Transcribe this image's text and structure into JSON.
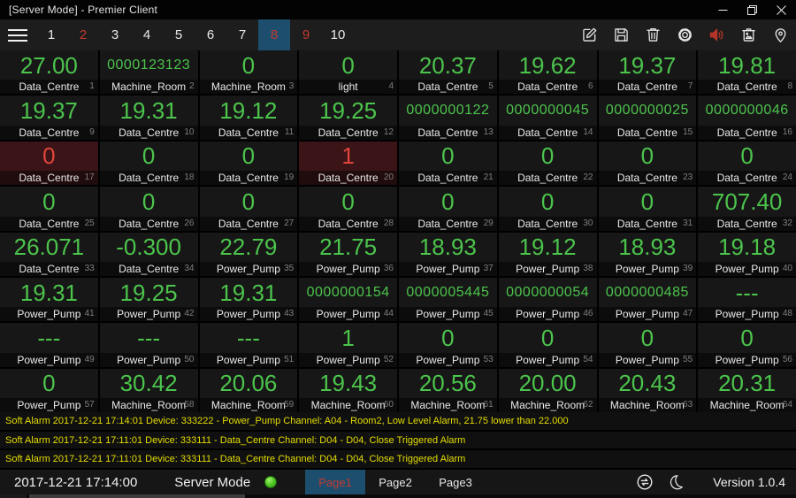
{
  "colors": {
    "accent_blue": "#1d4e6d",
    "value_green": "#4cc44c",
    "alarm_red": "#df453a",
    "page_red": "#c23b31",
    "alarm_text_yellow": "#e6de00",
    "alarm_cell_bg": "#3b1418"
  },
  "title_bar": {
    "title": "[Server Mode] - Premier Client"
  },
  "window_controls": {
    "icons": [
      "minimize-icon",
      "restore-icon",
      "close-icon"
    ]
  },
  "toolbar": {
    "pages": [
      {
        "label": "1",
        "state": "normal"
      },
      {
        "label": "2",
        "state": "alarm"
      },
      {
        "label": "3",
        "state": "normal"
      },
      {
        "label": "4",
        "state": "normal"
      },
      {
        "label": "5",
        "state": "normal"
      },
      {
        "label": "6",
        "state": "normal"
      },
      {
        "label": "7",
        "state": "normal"
      },
      {
        "label": "8",
        "state": "active"
      },
      {
        "label": "9",
        "state": "alarm"
      },
      {
        "label": "10",
        "state": "normal"
      }
    ],
    "icons": [
      "edit-icon",
      "save-icon",
      "delete-icon",
      "settings-icon",
      "audio-icon",
      "snapshot-icon",
      "location-icon"
    ]
  },
  "grid": {
    "cells": [
      {
        "value": "27.00",
        "label": "Data_Centre",
        "index": 1
      },
      {
        "value": "0000123123",
        "label": "Machine_Room",
        "index": 2
      },
      {
        "value": "0",
        "label": "Machine_Room",
        "index": 3
      },
      {
        "value": "0",
        "label": "light",
        "index": 4
      },
      {
        "value": "20.37",
        "label": "Data_Centre",
        "index": 5
      },
      {
        "value": "19.62",
        "label": "Data_Centre",
        "index": 6
      },
      {
        "value": "19.37",
        "label": "Data_Centre",
        "index": 7
      },
      {
        "value": "19.81",
        "label": "Data_Centre",
        "index": 8
      },
      {
        "value": "19.37",
        "label": "Data_Centre",
        "index": 9
      },
      {
        "value": "19.31",
        "label": "Data_Centre",
        "index": 10
      },
      {
        "value": "19.12",
        "label": "Data_Centre",
        "index": 11
      },
      {
        "value": "19.25",
        "label": "Data_Centre",
        "index": 12
      },
      {
        "value": "0000000122",
        "label": "Data_Centre",
        "index": 13
      },
      {
        "value": "0000000045",
        "label": "Data_Centre",
        "index": 14
      },
      {
        "value": "0000000025",
        "label": "Data_Centre",
        "index": 15
      },
      {
        "value": "0000000046",
        "label": "Data_Centre",
        "index": 16
      },
      {
        "value": "0",
        "label": "Data_Centre",
        "index": 17,
        "state": "alarm"
      },
      {
        "value": "0",
        "label": "Data_Centre",
        "index": 18
      },
      {
        "value": "0",
        "label": "Data_Centre",
        "index": 19
      },
      {
        "value": "1",
        "label": "Data_Centre",
        "index": 20,
        "state": "alarm"
      },
      {
        "value": "0",
        "label": "Data_Centre",
        "index": 21
      },
      {
        "value": "0",
        "label": "Data_Centre",
        "index": 22
      },
      {
        "value": "0",
        "label": "Data_Centre",
        "index": 23
      },
      {
        "value": "0",
        "label": "Data_Centre",
        "index": 24
      },
      {
        "value": "0",
        "label": "Data_Centre",
        "index": 25
      },
      {
        "value": "0",
        "label": "Data_Centre",
        "index": 26
      },
      {
        "value": "0",
        "label": "Data_Centre",
        "index": 27
      },
      {
        "value": "0",
        "label": "Data_Centre",
        "index": 28
      },
      {
        "value": "0",
        "label": "Data_Centre",
        "index": 29
      },
      {
        "value": "0",
        "label": "Data_Centre",
        "index": 30
      },
      {
        "value": "0",
        "label": "Data_Centre",
        "index": 31
      },
      {
        "value": "707.40",
        "label": "Data_Centre",
        "index": 32
      },
      {
        "value": "26.071",
        "label": "Data_Centre",
        "index": 33
      },
      {
        "value": "-0.300",
        "label": "Data_Centre",
        "index": 34
      },
      {
        "value": "22.79",
        "label": "Power_Pump",
        "index": 35
      },
      {
        "value": "21.75",
        "label": "Power_Pump",
        "index": 36
      },
      {
        "value": "18.93",
        "label": "Power_Pump",
        "index": 37
      },
      {
        "value": "19.12",
        "label": "Power_Pump",
        "index": 38
      },
      {
        "value": "18.93",
        "label": "Power_Pump",
        "index": 39
      },
      {
        "value": "19.18",
        "label": "Power_Pump",
        "index": 40
      },
      {
        "value": "19.31",
        "label": "Power_Pump",
        "index": 41
      },
      {
        "value": "19.25",
        "label": "Power_Pump",
        "index": 42
      },
      {
        "value": "19.31",
        "label": "Power_Pump",
        "index": 43
      },
      {
        "value": "0000000154",
        "label": "Power_Pump",
        "index": 44
      },
      {
        "value": "0000005445",
        "label": "Power_Pump",
        "index": 45
      },
      {
        "value": "0000000054",
        "label": "Power_Pump",
        "index": 46
      },
      {
        "value": "0000000485",
        "label": "Power_Pump",
        "index": 47
      },
      {
        "value": "---",
        "label": "Power_Pump",
        "index": 48
      },
      {
        "value": "---",
        "label": "Power_Pump",
        "index": 49
      },
      {
        "value": "---",
        "label": "Power_Pump",
        "index": 50
      },
      {
        "value": "---",
        "label": "Power_Pump",
        "index": 51
      },
      {
        "value": "1",
        "label": "Power_Pump",
        "index": 52
      },
      {
        "value": "0",
        "label": "Power_Pump",
        "index": 53
      },
      {
        "value": "0",
        "label": "Power_Pump",
        "index": 54
      },
      {
        "value": "0",
        "label": "Power_Pump",
        "index": 55
      },
      {
        "value": "0",
        "label": "Power_Pump",
        "index": 56
      },
      {
        "value": "0",
        "label": "Power_Pump",
        "index": 57
      },
      {
        "value": "30.42",
        "label": "Machine_Room",
        "index": 58
      },
      {
        "value": "20.06",
        "label": "Machine_Room",
        "index": 59
      },
      {
        "value": "19.43",
        "label": "Machine_Room",
        "index": 60
      },
      {
        "value": "20.56",
        "label": "Machine_Room",
        "index": 61
      },
      {
        "value": "20.00",
        "label": "Machine_Room",
        "index": 62
      },
      {
        "value": "20.43",
        "label": "Machine_Room",
        "index": 63
      },
      {
        "value": "20.31",
        "label": "Machine_Room",
        "index": 64
      }
    ]
  },
  "alarms": {
    "messages": [
      "Soft Alarm 2017-12-21 17:14:01 Device: 333222 - Power_Pump Channel: A04 - Room2, Low Level Alarm, 21.75 lower than 22.000",
      "Soft Alarm 2017-12-21 17:11:01 Device: 333111 - Data_Centre Channel: D04 - D04, Close Triggered Alarm",
      "Soft Alarm 2017-12-21 17:11:01 Device: 333111 - Data_Centre Channel: D04 - D04, Close Triggered Alarm"
    ]
  },
  "status_bar": {
    "timestamp": "2017-12-21 17:14:00",
    "mode_label": "Server Mode",
    "led_state": "green",
    "tabs": [
      {
        "label": "Page1",
        "active": true
      },
      {
        "label": "Page2",
        "active": false
      },
      {
        "label": "Page3",
        "active": false
      }
    ],
    "icons": [
      "sync-icon",
      "moon-icon"
    ],
    "version": "Version 1.0.4"
  }
}
